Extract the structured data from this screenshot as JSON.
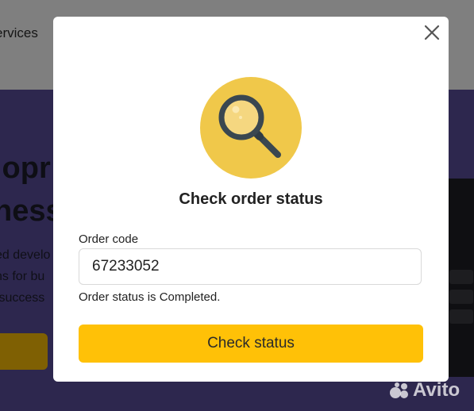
{
  "background": {
    "nav_text": "ervices",
    "hero_title": "lopr\nness",
    "hero_text": "ed develo\nns for bu\n success"
  },
  "modal": {
    "title": "Check order status",
    "order_code_label": "Order code",
    "order_code_value": "67233052",
    "status_message": "Order status is Completed.",
    "check_button_label": "Check status",
    "icon": "magnifier-icon",
    "close_icon": "close-icon"
  },
  "watermark": {
    "text": "Avito"
  },
  "colors": {
    "accent": "#ffc107",
    "icon_circle": "#f0c84a",
    "hero_bg": "#5b4f9c"
  }
}
